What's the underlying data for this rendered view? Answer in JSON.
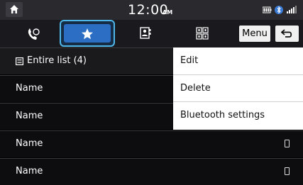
{
  "status_bar": {
    "time": "12:00",
    "ampm": "AM",
    "home_icon": "home-icon",
    "status_icons": [
      "battery-icon",
      "bluetooth-icon",
      "signal-icon"
    ]
  },
  "tabs": [
    {
      "name": "recent-calls",
      "icon": "phone-recent-icon"
    },
    {
      "name": "favorites",
      "icon": "star-icon",
      "selected": true
    },
    {
      "name": "contacts",
      "icon": "contacts-icon"
    },
    {
      "name": "dial-pad",
      "icon": "keypad-icon"
    }
  ],
  "toolbar": {
    "menu_label": "Menu",
    "back_icon": "back-icon"
  },
  "list": {
    "header": "Entire list (4)",
    "items": [
      {
        "name": "Name"
      },
      {
        "name": "Name"
      },
      {
        "name": "Name"
      },
      {
        "name": "Name"
      }
    ]
  },
  "menu": {
    "items": [
      {
        "label": "Edit"
      },
      {
        "label": "Delete"
      },
      {
        "label": "Bluetooth settings"
      }
    ]
  },
  "colors": {
    "accent": "#4fb7ea",
    "selected_tab": "#2c6ec3"
  }
}
